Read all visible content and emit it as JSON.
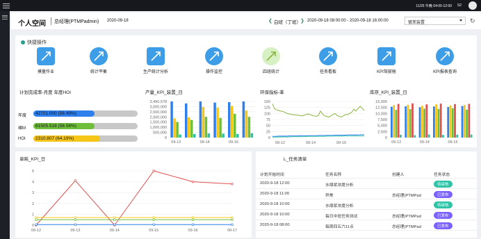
{
  "topbar": {
    "datetime": "11/25 午晚 04:00-12:00",
    "s2": "S2"
  },
  "header": {
    "title": "个人空间",
    "user": "总经理(PTMPadmin)",
    "date": "2020-09-18",
    "shift": "白班（丁班）",
    "range": "2020-09-18 08:00:00 - 2020-09-18 16:00:00",
    "select_value": "镀苯装置"
  },
  "quick": {
    "title": "快捷操作",
    "items": [
      {
        "label": "摸量作业",
        "icon": "workflow-icon"
      },
      {
        "label": "统计平衡",
        "icon": "balance-icon"
      },
      {
        "label": "生产统计分析",
        "icon": "document-search-icon"
      },
      {
        "label": "操作监控",
        "icon": "monitor-icon"
      },
      {
        "label": "四班统计",
        "icon": "shift-stats-icon"
      },
      {
        "label": "任务看板",
        "icon": "task-board-icon"
      },
      {
        "label": "KPI驾驶舱",
        "icon": "bar-chart-icon"
      },
      {
        "label": "KPI报表查询",
        "icon": "report-query-icon"
      }
    ]
  },
  "plan": {
    "title": "计划完成率-月度        年度HOI",
    "rows": [
      {
        "label": "年度",
        "value": "42701.000 (58.49%)",
        "pct": 58.49,
        "color": "#2f80ed"
      },
      {
        "label": "裙M",
        "value": "61505.518 (58.58%)",
        "pct": 58.58,
        "color": "#6fbf3b"
      },
      {
        "label": "HOI",
        "value": "2310.807 (64.19%)",
        "pct": 64.19,
        "color": "#f5c518"
      }
    ]
  },
  "output_card": {
    "title": "产量_KPI_装置_日"
  },
  "env_card": {
    "title": "环保指标-苯"
  },
  "stock_card": {
    "title": "库存_KPI_装置_日"
  },
  "consume_card": {
    "title": "单耗_KPI_日"
  },
  "task_card": {
    "title": "L_任务清单",
    "columns": [
      "计划开始时间",
      "任务名称",
      "创建人",
      "任务状态"
    ],
    "rows": [
      {
        "time": "2020-9-18 12:00",
        "name": "水煤浆浓度分析",
        "creator": "",
        "status": "待审核",
        "status_color": "#2ec2a7"
      },
      {
        "time": "2020-9-18 11:00",
        "name": "异常",
        "creator": "总经理(PTMPad",
        "status": "已发布",
        "status_color": "#7b61ff"
      },
      {
        "time": "2020-9-18 10:00",
        "name": "水煤浆浓度分析",
        "creator": "",
        "status": "待审核",
        "status_color": "#2ec2a7"
      },
      {
        "time": "2020-9-18 10:00",
        "name": "每日中班任务测试",
        "creator": "总经理(PTMPad",
        "status": "已发布",
        "status_color": "#7b61ff"
      },
      {
        "time": "2020-9-18 08:00",
        "name": "每周四五六11点",
        "creator": "总经理(PTMPad",
        "status": "已发布",
        "status_color": "#7b61ff"
      }
    ]
  },
  "chart_data": [
    {
      "type": "bar",
      "title": "产量_KPI_装置_日",
      "categories": [
        "09-12",
        "09-13",
        "09-14",
        "09-15",
        "09-16",
        "09-17"
      ],
      "ytick_labels": [
        "3,490,578",
        "3,000,000",
        "2,500,000",
        "2,000,000",
        "1,500,000",
        "1,000,000",
        "500,000",
        "0"
      ],
      "xtick_labels": [
        "09-12",
        "09-14",
        "09-16"
      ],
      "ylim": [
        0,
        3490578
      ],
      "series": [
        {
          "color": "#2f80ed",
          "values": [
            3490578,
            3300000,
            3490578,
            3380000,
            3420000,
            3490578
          ]
        },
        {
          "color": "#f5c518",
          "values": [
            1850000,
            1950000,
            2950000,
            2900000,
            3050000,
            2600000
          ]
        },
        {
          "color": "#6fbf3b",
          "values": [
            1500000,
            1700000,
            2000000,
            1900000,
            2300000,
            2000000
          ]
        },
        {
          "color": "#2ec2a7",
          "values": [
            300000,
            350000,
            400000,
            380000,
            350000,
            420000
          ]
        }
      ]
    },
    {
      "type": "line",
      "title": "环保指标-苯",
      "ytick_labels": [
        "150",
        "125",
        "100",
        "75",
        "50",
        "25",
        "0"
      ],
      "xtick_labels": [
        "09-12",
        "09-14",
        "09-16"
      ],
      "ylim": [
        0,
        150
      ],
      "series": [
        {
          "color": "#8ab43f",
          "values": [
            140,
            120,
            115,
            112,
            110,
            108,
            105,
            100,
            98,
            96,
            95,
            94,
            93,
            92,
            90,
            92,
            95,
            98,
            96,
            92,
            90,
            88,
            92,
            110,
            98,
            90,
            88,
            85,
            90,
            95,
            100,
            92,
            88,
            86,
            90,
            96,
            95,
            100,
            105,
            118,
            110,
            120,
            130,
            122,
            112
          ]
        },
        {
          "color": "#2f80ed",
          "values": [
            5,
            5,
            5,
            6,
            6,
            6,
            6,
            6,
            7,
            7,
            7,
            7,
            7,
            8,
            8,
            8,
            8,
            8,
            8,
            8,
            8,
            8,
            9,
            9,
            9,
            9,
            9,
            9,
            9,
            9,
            10,
            10,
            10,
            10,
            10,
            10,
            11,
            11,
            11,
            11,
            11,
            11,
            12,
            12,
            12
          ]
        },
        {
          "color": "#2ec2a7",
          "values": [
            2,
            2,
            2,
            3,
            3,
            3,
            3,
            3,
            3,
            4,
            4,
            4,
            4,
            4,
            4,
            4,
            4,
            5,
            5,
            5,
            5,
            5,
            5,
            5,
            5,
            5,
            6,
            6,
            6,
            6,
            6,
            6,
            6,
            6,
            6,
            7,
            7,
            7,
            7,
            7,
            7,
            7,
            7,
            7,
            7
          ]
        }
      ]
    },
    {
      "type": "bar",
      "title": "库存_KPI_装置_日",
      "categories": [
        "09-12",
        "09-13",
        "09-14",
        "09-15",
        "09-16",
        "09-17"
      ],
      "ytick_labels": [
        "15,000",
        "12,500",
        "10,000",
        "7,500",
        "5,000",
        "2,500",
        "0"
      ],
      "xtick_labels": [
        "09-12",
        "09-14",
        "09-16"
      ],
      "ylim": [
        0,
        15000
      ],
      "series": [
        {
          "color": "#2f80ed",
          "values": [
            12800,
            13000,
            12600,
            12900,
            12700,
            13100
          ]
        },
        {
          "color": "#f5c518",
          "values": [
            13500,
            13600,
            13200,
            13800,
            13400,
            13500
          ]
        },
        {
          "color": "#6fbf3b",
          "values": [
            11500,
            11800,
            12000,
            11900,
            12200,
            11600
          ]
        },
        {
          "color": "#e05050",
          "values": [
            14000,
            14200,
            13800,
            14100,
            13900,
            14000
          ]
        },
        {
          "color": "#2ec2a7",
          "values": [
            1200,
            1000,
            1300,
            1100,
            1200,
            1250
          ]
        }
      ]
    },
    {
      "type": "line",
      "title": "单耗_KPI_日",
      "categories": [
        "09-12",
        "09-13",
        "09-14",
        "09-15",
        "09-16",
        "09-17"
      ],
      "ytick_labels": [
        "5",
        "4",
        "3",
        "2",
        "1",
        "0"
      ],
      "ylim": [
        0,
        5
      ],
      "series": [
        {
          "color": "#e05050",
          "values": [
            0,
            4.1,
            0,
            5,
            4,
            3.8
          ]
        },
        {
          "color": "#f5c518",
          "values": [
            0.7,
            0.7,
            0.7,
            0.7,
            0.7,
            0.7
          ]
        },
        {
          "color": "#6fbf3b",
          "values": [
            0.5,
            0.5,
            0.5,
            0.5,
            0.5,
            0.5
          ]
        },
        {
          "color": "#2f80ed",
          "values": [
            0.05,
            0.05,
            0.05,
            0.05,
            0.05,
            0.05
          ]
        }
      ]
    }
  ]
}
